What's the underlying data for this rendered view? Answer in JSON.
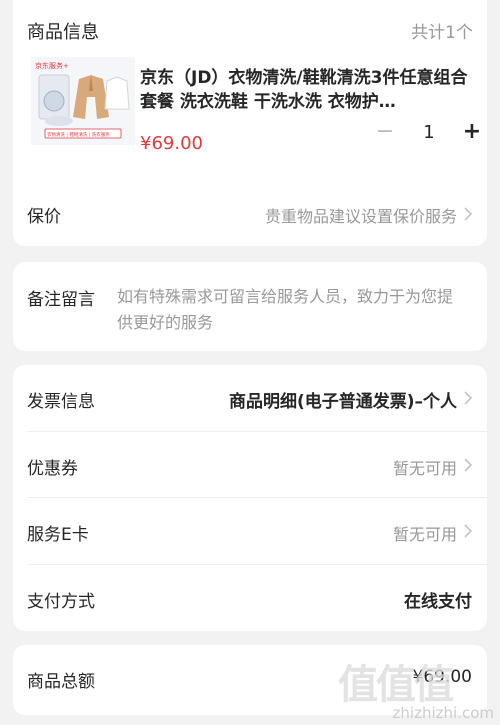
{
  "goods": {
    "section_title": "商品信息",
    "count_text": "共计1个",
    "product": {
      "image_brand": "京东服务+",
      "image_tags": "衣物清洗 | 鞋靴清洗 | 洗衣服务",
      "name": "京东（JD）衣物清洗/鞋靴清洗3件任意组合套餐 洗衣洗鞋 干洗水洗 衣物护…",
      "price": "¥69.00",
      "quantity": "1",
      "minus_symbol": "−",
      "plus_symbol": "+"
    },
    "insurance": {
      "label": "保价",
      "value": "贵重物品建议设置保价服务"
    }
  },
  "note": {
    "label": "备注留言",
    "placeholder": "如有特殊需求可留言给服务人员，致力于为您提供更好的服务"
  },
  "order_rows": [
    {
      "label": "发票信息",
      "value": "商品明细(电子普通发票)–个人"
    },
    {
      "label": "优惠券",
      "value": "暂无可用"
    },
    {
      "label": "服务E卡",
      "value": "暂无可用"
    },
    {
      "label": "支付方式",
      "value": "在线支付"
    }
  ],
  "total": {
    "label": "商品总额",
    "value": "¥69.00"
  },
  "watermark": {
    "logo": "值值值",
    "url": "zhizhizhi.com"
  },
  "colors": {
    "price": "#e4393c",
    "background": "#f2f2f2",
    "muted": "#999999"
  },
  "icons": [
    "chevron-right-icon",
    "minus-icon",
    "plus-icon"
  ]
}
